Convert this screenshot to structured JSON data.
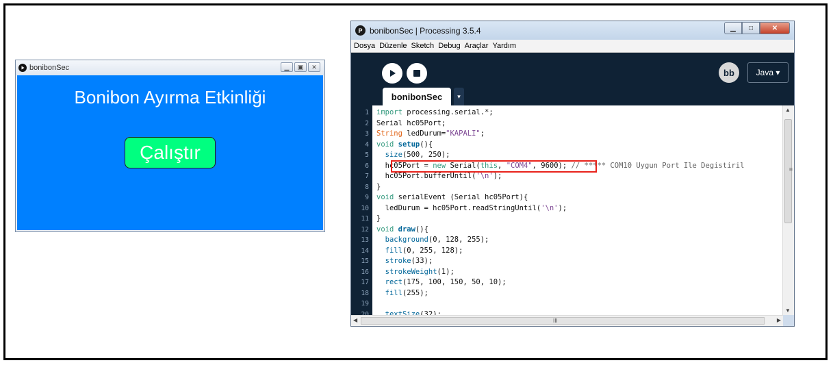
{
  "sketch_window": {
    "title": "bonibonSec",
    "heading": "Bonibon Ayırma Etkinliği",
    "button_label": "Çalıştır"
  },
  "ide": {
    "title": "bonibonSec | Processing 3.5.4",
    "logo_letter": "P",
    "menu": [
      "Dosya",
      "Düzenle",
      "Sketch",
      "Debug",
      "Araçlar",
      "Yardım"
    ],
    "mode_label": "Java ▾",
    "debug_icon": "bb",
    "tab_name": "bonibonSec",
    "tab_arrow": "▾",
    "scroll_grip": "III"
  },
  "code_lines": [
    {
      "n": "1",
      "html": "<span class=\"kw\">import</span> processing.serial.*;"
    },
    {
      "n": "2",
      "html": "Serial hc05Port;"
    },
    {
      "n": "3",
      "html": "<span class=\"type\">String</span> ledDurum=<span class=\"str\">\"KAPALI\"</span>;"
    },
    {
      "n": "4",
      "html": "<span class=\"kw\">void</span> <span class=\"fn\">setup</span>(){"
    },
    {
      "n": "5",
      "html": "  <span class=\"bi\">size</span>(500, 250);"
    },
    {
      "n": "6",
      "html": "  hc05Port = <span class=\"kw\">new</span> Serial(<span class=\"kw\">this</span>, <span class=\"str\">\"COM4\"</span>, 9600); <span class=\"cm\">// ***** COM10 Uygun Port Ile Degistiril</span>"
    },
    {
      "n": "7",
      "html": "  hc05Port.bufferUntil(<span class=\"str\">'\\n'</span>);"
    },
    {
      "n": "8",
      "html": "}"
    },
    {
      "n": "9",
      "html": "<span class=\"kw\">void</span> serialEvent (Serial hc05Port){"
    },
    {
      "n": "10",
      "html": "  ledDurum = hc05Port.readStringUntil(<span class=\"str\">'\\n'</span>);"
    },
    {
      "n": "11",
      "html": "}"
    },
    {
      "n": "12",
      "html": "<span class=\"kw\">void</span> <span class=\"fn\">draw</span>(){"
    },
    {
      "n": "13",
      "html": "  <span class=\"bi\">background</span>(0, 128, 255);"
    },
    {
      "n": "14",
      "html": "  <span class=\"bi\">fill</span>(0, 255, 128);"
    },
    {
      "n": "15",
      "html": "  <span class=\"bi\">stroke</span>(33);"
    },
    {
      "n": "16",
      "html": "  <span class=\"bi\">strokeWeight</span>(1);"
    },
    {
      "n": "17",
      "html": "  <span class=\"bi\">rect</span>(175, 100, 150, 50, 10);"
    },
    {
      "n": "18",
      "html": "  <span class=\"bi\">fill</span>(255);"
    },
    {
      "n": "19",
      "html": ""
    },
    {
      "n": "20",
      "html": "  <span class=\"bi\">textSize</span>(32);"
    }
  ],
  "colors": {
    "sketch_background": "#0080ff",
    "button_fill": "#00ff80",
    "ide_toolbar": "#0f2235",
    "highlight_box": "#e8221b"
  }
}
